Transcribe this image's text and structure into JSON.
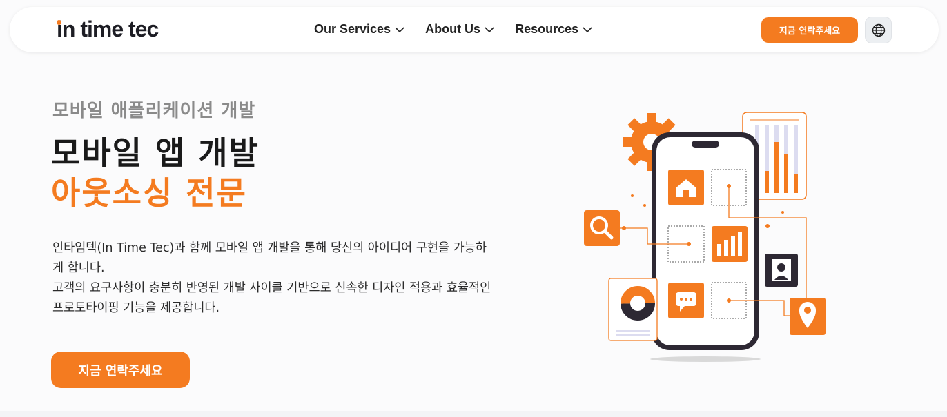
{
  "header": {
    "logo_text": "in time tec",
    "nav": [
      {
        "label": "Our Services"
      },
      {
        "label": "About Us"
      },
      {
        "label": "Resources"
      }
    ],
    "cta_label": "지금 연락주세요",
    "language_icon": "globe-icon"
  },
  "hero": {
    "eyebrow": "모바일 애플리케이션 개발",
    "headline": "모바일 앱 개발",
    "headline_accent": "아웃소싱 전문",
    "description_1": "인타임텍(In Time Tec)과 함께 모바일 앱 개발을 통해 당신의 아이디어 구현을 가능하게 합니다.",
    "description_2": "고객의 요구사항이 충분히 반영된 개발 사이클 기반으로 신속한 디자인 적용과 효율적인 프로토타이핑 기능을 제공합니다.",
    "cta_label": "지금 연락주세요"
  },
  "colors": {
    "accent": "#f47b20",
    "text_dark": "#1a1a1a",
    "eyebrow_gray": "#8a8a8a"
  },
  "illustration_icons": [
    "gear-icon",
    "home-icon",
    "bar-chart-icon",
    "chat-icon",
    "search-icon",
    "user-icon",
    "location-pin-icon",
    "donut-chart-icon",
    "smartphone-icon"
  ]
}
